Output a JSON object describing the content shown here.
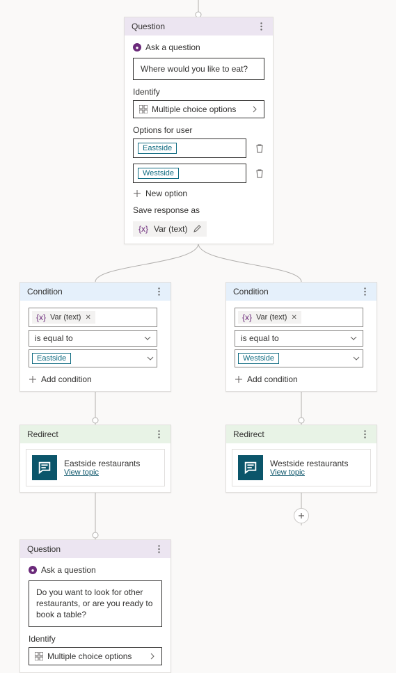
{
  "q1": {
    "title": "Question",
    "ask_label": "Ask a question",
    "text": "Where would you like to eat?",
    "identify_label": "Identify",
    "identify_value": "Multiple choice options",
    "options_label": "Options for user",
    "options": [
      "Eastside",
      "Westside"
    ],
    "new_option": "New option",
    "save_label": "Save response as",
    "var": "Var (text)"
  },
  "cond_left": {
    "title": "Condition",
    "var": "Var (text)",
    "operator": "is equal to",
    "value": "Eastside",
    "add": "Add condition"
  },
  "cond_right": {
    "title": "Condition",
    "var": "Var (text)",
    "operator": "is equal to",
    "value": "Westside",
    "add": "Add condition"
  },
  "redir_left": {
    "title": "Redirect",
    "topic": "Eastside restaurants",
    "link": "View topic"
  },
  "redir_right": {
    "title": "Redirect",
    "topic": "Westside restaurants",
    "link": "View topic"
  },
  "q2": {
    "title": "Question",
    "ask_label": "Ask a question",
    "text": "Do you want to look for other restaurants, or are you ready to book a table?",
    "identify_label": "Identify",
    "identify_value": "Multiple choice options"
  }
}
